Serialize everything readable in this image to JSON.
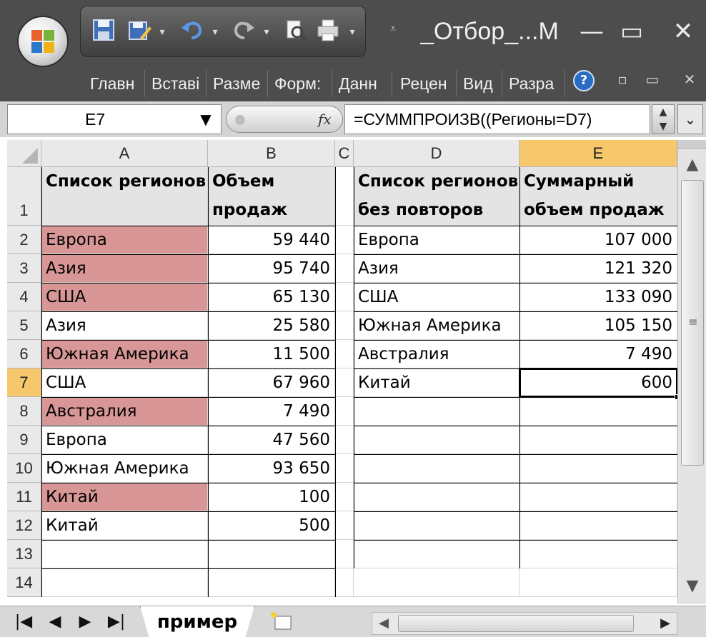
{
  "window": {
    "title": "_Отбор_...М",
    "minimize": "—",
    "maximize": "▭",
    "close": "✕"
  },
  "quick_access": {
    "save_icon": "save-icon",
    "undo_icon": "undo-icon",
    "redo_icon": "redo-icon",
    "print_icon": "print-icon",
    "dropdown": "▾",
    "customize": "⩡"
  },
  "ribbon": {
    "tabs": [
      "Главн",
      "Вставі",
      "Разме",
      "Форм:",
      "Данн",
      "Рецен",
      "Вид",
      "Разра"
    ],
    "help": "?",
    "minimize": "▫",
    "restore": "▭",
    "close": "✕"
  },
  "formula_bar": {
    "name_box": "E7",
    "fx_label": "fx",
    "formula": "=СУММПРОИЗВ((Регионы=D7)"
  },
  "sheet": {
    "columns": [
      "A",
      "B",
      "C",
      "D",
      "E"
    ],
    "rows": [
      "1",
      "2",
      "3",
      "4",
      "5",
      "6",
      "7",
      "8",
      "9",
      "10",
      "11",
      "12",
      "13",
      "14"
    ],
    "active_cell": "E7",
    "header_row": {
      "A": "Список регионов",
      "B1": "Объем",
      "B2": "продаж",
      "D1": "Список регионов",
      "D2": "без повторов",
      "E1": "Суммарный",
      "E2": "объем продаж"
    },
    "source_table": [
      {
        "region": "Европа",
        "sales": "59 440",
        "highlight": true
      },
      {
        "region": "Азия",
        "sales": "95 740",
        "highlight": true
      },
      {
        "region": "США",
        "sales": "65 130",
        "highlight": true
      },
      {
        "region": "Азия",
        "sales": "25 580",
        "highlight": false
      },
      {
        "region": "Южная Америка",
        "sales": "11 500",
        "highlight": true
      },
      {
        "region": "США",
        "sales": "67 960",
        "highlight": false
      },
      {
        "region": "Австралия",
        "sales": "7 490",
        "highlight": true
      },
      {
        "region": "Европа",
        "sales": "47 560",
        "highlight": false
      },
      {
        "region": "Южная Америка",
        "sales": "93 650",
        "highlight": false
      },
      {
        "region": "Китай",
        "sales": "100",
        "highlight": true
      },
      {
        "region": "Китай",
        "sales": "500",
        "highlight": false
      }
    ],
    "summary_table": [
      {
        "region": "Европа",
        "total": "107 000"
      },
      {
        "region": "Азия",
        "total": "121 320"
      },
      {
        "region": "США",
        "total": "133 090"
      },
      {
        "region": "Южная Америка",
        "total": "105 150"
      },
      {
        "region": "Австралия",
        "total": "7 490"
      },
      {
        "region": "Китай",
        "total": "600"
      }
    ],
    "highlight_color": "#d89796",
    "header_fill": "#e4e4e4",
    "active_header_color": "#f7c86b"
  },
  "sheet_tabs": {
    "nav_first": "|◀",
    "nav_prev": "◀",
    "nav_next": "▶",
    "nav_last": "▶|",
    "active_tab": "пример",
    "new_sheet_icon": "new-sheet-icon"
  },
  "scrollbars": {
    "up": "▲",
    "down": "▼",
    "left": "◀",
    "right": "▶",
    "grip": "≡"
  }
}
